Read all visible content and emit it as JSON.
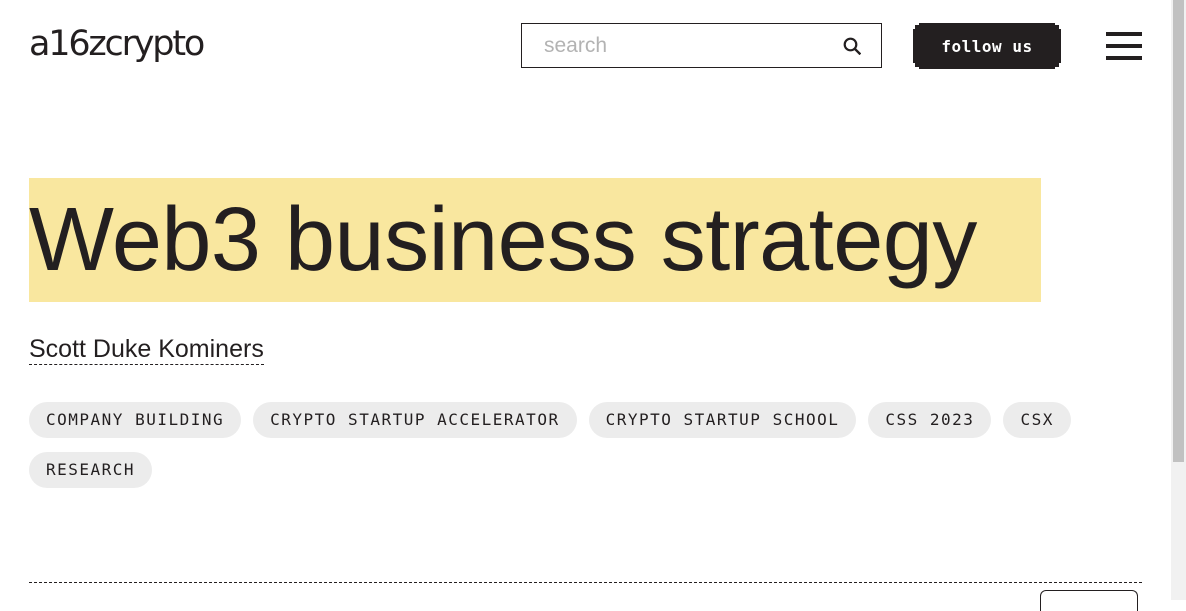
{
  "header": {
    "logo": "a16zcrypto",
    "search": {
      "placeholder": "search",
      "value": ""
    },
    "follow_label": "follow us"
  },
  "icons": {
    "search": "search-icon",
    "menu": "hamburger-menu-icon"
  },
  "colors": {
    "highlight": "#f9e79f",
    "ink": "#231f20",
    "tag_background": "#ececec"
  },
  "article": {
    "title": "Web3 business strategy",
    "author": "Scott Duke Kominers",
    "tags": [
      "COMPANY BUILDING",
      "CRYPTO STARTUP ACCELERATOR",
      "CRYPTO STARTUP SCHOOL",
      "CSS 2023",
      "CSX",
      "RESEARCH"
    ]
  }
}
